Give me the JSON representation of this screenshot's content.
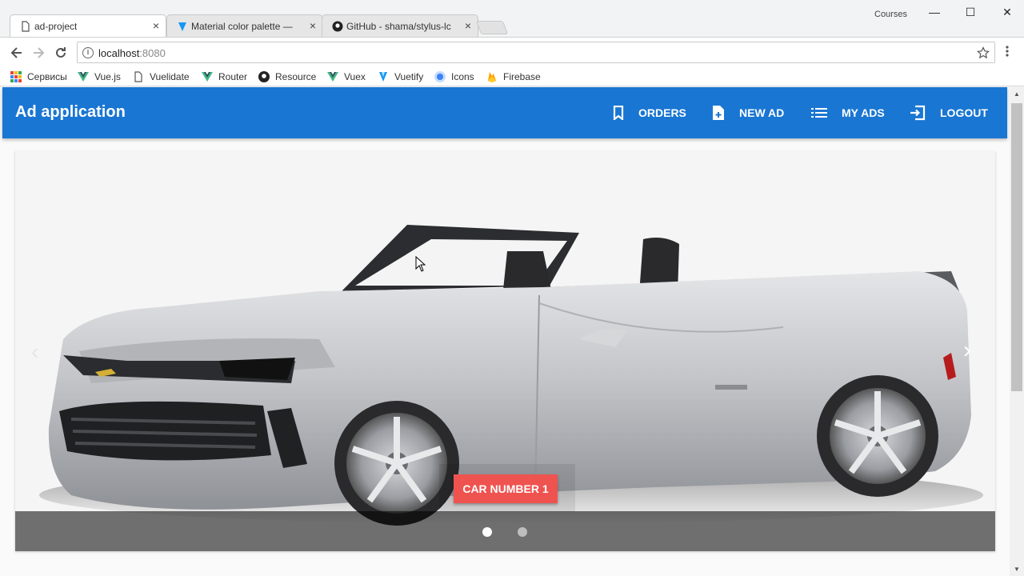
{
  "browser": {
    "tabs": [
      {
        "label": "ad-project",
        "icon": "document-icon",
        "active": true
      },
      {
        "label": "Material color palette —",
        "icon": "vuetify-icon"
      },
      {
        "label": "GitHub - shama/stylus-lc",
        "icon": "github-icon"
      }
    ],
    "profile_label": "Courses",
    "close_glyph": "×",
    "window_controls": {
      "minimize": "—",
      "maximize": "☐",
      "close": "✕"
    },
    "url": {
      "host": "localhost",
      "port": ":8080"
    },
    "bookmarks": [
      {
        "label": "Сервисы",
        "icon": "apps-icon"
      },
      {
        "label": "Vue.js",
        "icon": "vue-icon"
      },
      {
        "label": "Vuelidate",
        "icon": "document-icon"
      },
      {
        "label": "Router",
        "icon": "vue-icon"
      },
      {
        "label": "Resource",
        "icon": "github-icon"
      },
      {
        "label": "Vuex",
        "icon": "vue-icon"
      },
      {
        "label": "Vuetify",
        "icon": "vuetify-icon"
      },
      {
        "label": "Icons",
        "icon": "icons-icon"
      },
      {
        "label": "Firebase",
        "icon": "firebase-icon"
      }
    ]
  },
  "app": {
    "title": "Ad application",
    "primary_color": "#1976d2",
    "nav": [
      {
        "label": "ORDERS",
        "icon": "bookmark-icon"
      },
      {
        "label": "NEW AD",
        "icon": "note-add-icon"
      },
      {
        "label": "MY ADS",
        "icon": "list-icon"
      },
      {
        "label": "LOGOUT",
        "icon": "exit-icon"
      }
    ]
  },
  "carousel": {
    "slide_button": "CAR NUMBER 1",
    "button_color": "#ef5350",
    "active_slide": 1,
    "slide_count": 2,
    "prev_glyph": "‹",
    "next_glyph": "›"
  }
}
